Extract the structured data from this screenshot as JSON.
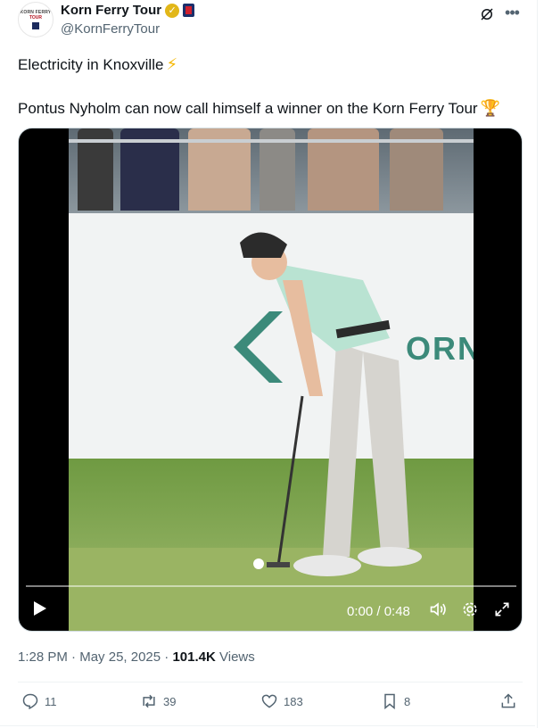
{
  "author": {
    "display_name": "Korn Ferry Tour",
    "handle": "@KornFerryTour",
    "avatar_line1": "KORN FERRY",
    "avatar_line2": "TOUR",
    "verified_icon": "gold-check-icon",
    "affiliation_icon": "pga-tour-badge-icon"
  },
  "tweet": {
    "line1": "Electricity in Knoxville",
    "line1_emoji": "⚡",
    "line2": "Pontus Nyholm can now call himself a winner on the Korn Ferry Tour",
    "line2_emoji": "🏆"
  },
  "video": {
    "time": "0:00 / 0:48",
    "progress": 0,
    "wall_logo_text": "ORN",
    "icons": [
      "play-icon",
      "volume-icon",
      "settings-icon",
      "fullscreen-icon"
    ]
  },
  "meta": {
    "time": "1:28 PM",
    "sep1": "·",
    "date": "May 25, 2025",
    "sep2": "·",
    "views_count": "101.4K",
    "views_label": "Views"
  },
  "actions": {
    "replies": "11",
    "reposts": "39",
    "likes": "183",
    "bookmarks": "8"
  },
  "colors": {
    "text": "#0f1419",
    "secondary": "#536471",
    "verified": "#e2b719",
    "wall_logo": "#3c8a7a"
  }
}
